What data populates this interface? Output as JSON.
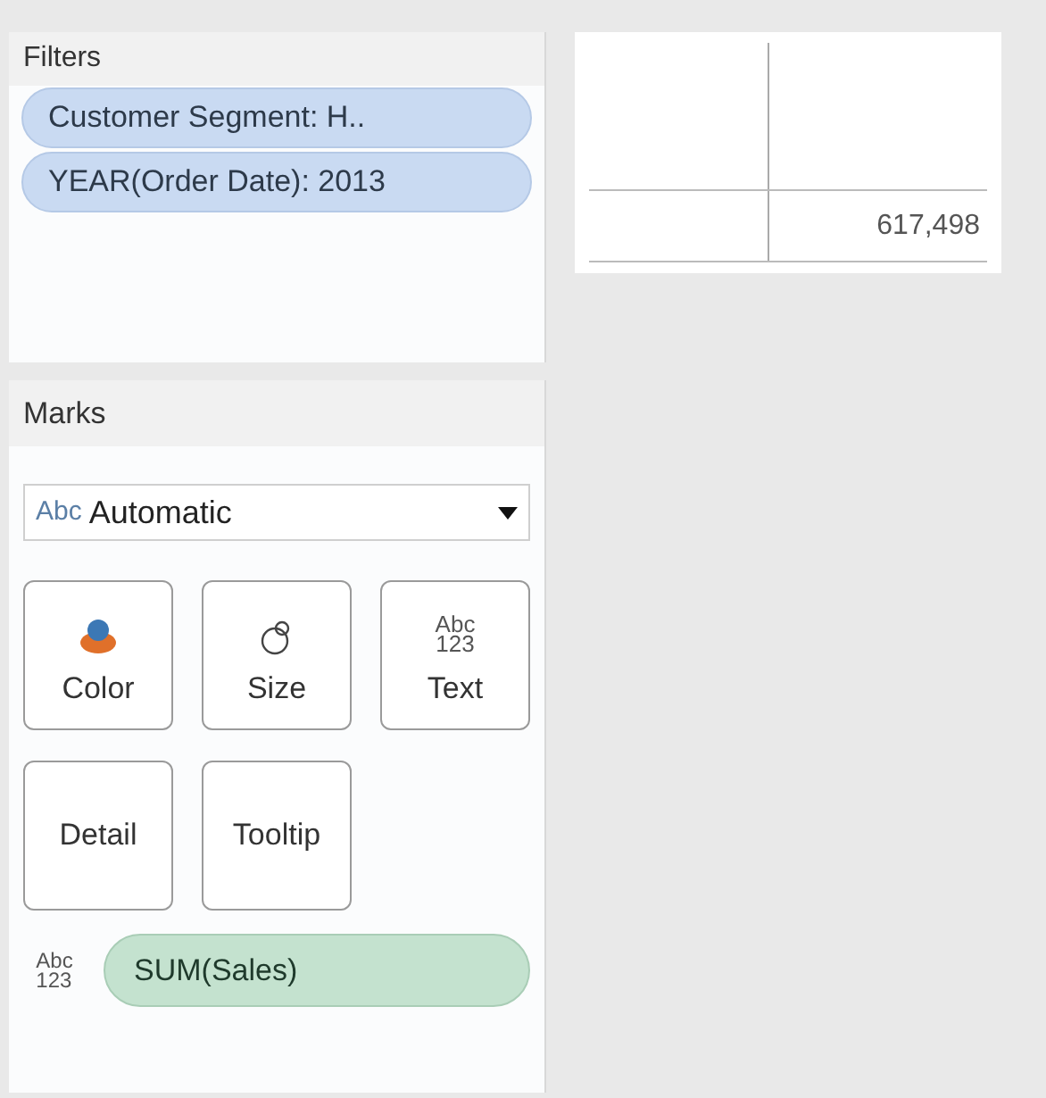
{
  "filters": {
    "title": "Filters",
    "pills": [
      {
        "label": "Customer Segment: H.."
      },
      {
        "label": "YEAR(Order Date): 2013"
      }
    ]
  },
  "marks": {
    "title": "Marks",
    "mark_type": {
      "icon_text": "Abc",
      "value": "Automatic"
    },
    "buttons": [
      {
        "kind": "color",
        "label": "Color"
      },
      {
        "kind": "size",
        "label": "Size"
      },
      {
        "kind": "text",
        "label": "Text",
        "icon_lines": [
          "Abc",
          "123"
        ]
      },
      {
        "kind": "detail",
        "label": "Detail"
      },
      {
        "kind": "tooltip",
        "label": "Tooltip"
      }
    ],
    "fields": [
      {
        "icon_lines": [
          "Abc",
          "123"
        ],
        "label": "SUM(Sales)"
      }
    ]
  },
  "view": {
    "value": "617,498"
  }
}
